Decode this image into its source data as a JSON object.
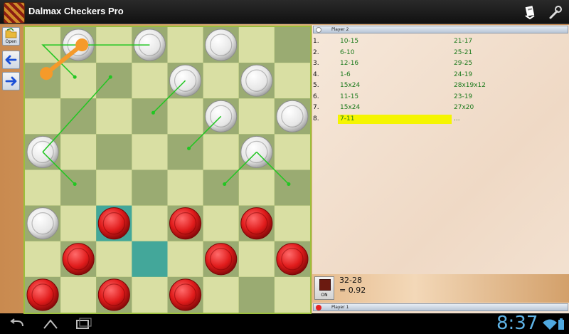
{
  "app": {
    "title": "Dalmax Checkers Pro"
  },
  "sidebar": {
    "open_label": "Open"
  },
  "board": {
    "size": 8,
    "light_color": "#d9dfa3",
    "dark_color": "#9aab72",
    "highlight_color": "#43a79a",
    "highlight_squares": [
      [
        5,
        2
      ],
      [
        6,
        3
      ]
    ],
    "white_pieces": [
      [
        0,
        1
      ],
      [
        0,
        3
      ],
      [
        0,
        5
      ],
      [
        1,
        4
      ],
      [
        1,
        6
      ],
      [
        2,
        5
      ],
      [
        2,
        7
      ],
      [
        3,
        0
      ],
      [
        3,
        6
      ],
      [
        5,
        0
      ]
    ],
    "red_pieces": [
      [
        5,
        2
      ],
      [
        5,
        4
      ],
      [
        5,
        6
      ],
      [
        6,
        1
      ],
      [
        6,
        5
      ],
      [
        6,
        7
      ],
      [
        7,
        0
      ],
      [
        7,
        2
      ],
      [
        7,
        4
      ]
    ],
    "hint_lines": [
      [
        [
          0.5,
          3.5
        ],
        [
          0.5,
          0.5
        ],
        [
          1.4,
          1.4
        ]
      ],
      [
        [
          3.5,
          0.5
        ],
        [
          1.4,
          2.4
        ]
      ],
      [
        [
          1.5,
          4.5
        ],
        [
          2.4,
          3.6
        ]
      ],
      [
        [
          2.5,
          5.5
        ],
        [
          3.4,
          4.6
        ]
      ],
      [
        [
          3.5,
          6.5
        ],
        [
          4.4,
          5.6
        ]
      ],
      [
        [
          3.5,
          6.5
        ],
        [
          4.4,
          7.4
        ]
      ],
      [
        [
          3.5,
          0.5
        ],
        [
          4.4,
          1.4
        ]
      ]
    ],
    "last_move": [
      [
        1.3,
        0.6
      ],
      [
        0.5,
        1.6
      ]
    ]
  },
  "panel": {
    "top_player": "Player 2",
    "bottom_player": "Player 1",
    "top_player_color": "#ffffff",
    "bottom_player_color": "#e52222",
    "moves": [
      {
        "num": "1.",
        "white": "10-15",
        "red": "21-17"
      },
      {
        "num": "2.",
        "white": "6-10",
        "red": "25-21"
      },
      {
        "num": "3.",
        "white": "12-16",
        "red": "29-25"
      },
      {
        "num": "4.",
        "white": "1-6",
        "red": "24-19"
      },
      {
        "num": "5.",
        "white": "15x24",
        "red": "28x19x12"
      },
      {
        "num": "6.",
        "white": "11-15",
        "red": "23-19"
      },
      {
        "num": "7.",
        "white": "15x24",
        "red": "27x20"
      },
      {
        "num": "8.",
        "white": "7-11",
        "red": "..."
      }
    ],
    "current_move_index": 7,
    "eval_move": "32-28",
    "eval_score": "= 0.92",
    "engine_button_label": "ON"
  },
  "status": {
    "clock": "8:37"
  }
}
